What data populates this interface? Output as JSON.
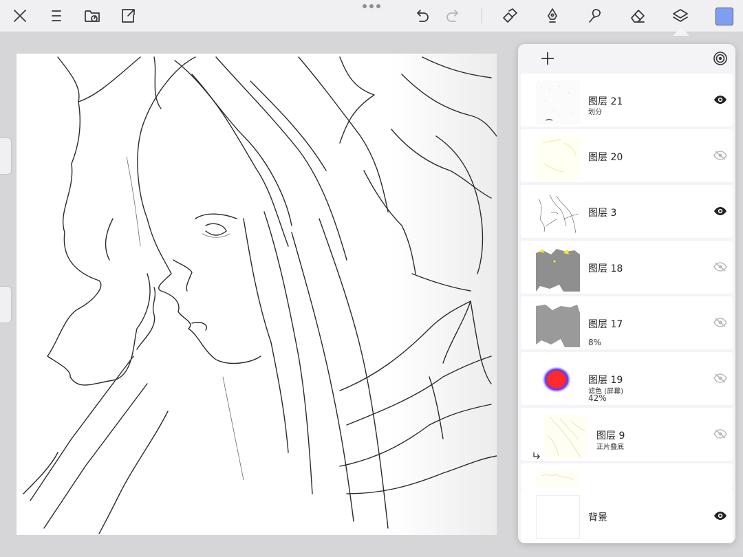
{
  "toolbar": {
    "close": "close-icon",
    "menu": "menu-icon",
    "gallery": "gallery-icon",
    "export": "export-icon",
    "undo": "undo-icon",
    "redo": "redo-icon",
    "selection": "selection-icon",
    "pen": "pen-icon",
    "smudge": "smudge-icon",
    "eraser": "eraser-icon",
    "layers": "layers-icon",
    "color_swatch": "#7f9ef2"
  },
  "layers_panel": {
    "add_icon": "plus-icon",
    "options_icon": "layer-options-icon",
    "layers": [
      {
        "name": "图层 21",
        "sub": "划分",
        "opacity": "",
        "visible": true,
        "clipped": false
      },
      {
        "name": "图层 20",
        "sub": "",
        "opacity": "",
        "visible": false,
        "clipped": false
      },
      {
        "name": "图层 3",
        "sub": "",
        "opacity": "",
        "visible": true,
        "clipped": false
      },
      {
        "name": "图层 18",
        "sub": "",
        "opacity": "",
        "visible": false,
        "clipped": false
      },
      {
        "name": "图层 17",
        "sub": "",
        "opacity": "8%",
        "visible": false,
        "clipped": false
      },
      {
        "name": "图层 19",
        "sub": "滤色 (屏幕)",
        "opacity": "42%",
        "visible": false,
        "clipped": false
      },
      {
        "name": "图层 9",
        "sub": "正片叠底",
        "opacity": "",
        "visible": false,
        "clipped": true
      },
      {
        "name": "背景",
        "sub": "",
        "opacity": "",
        "visible": true,
        "clipped": false
      }
    ]
  }
}
